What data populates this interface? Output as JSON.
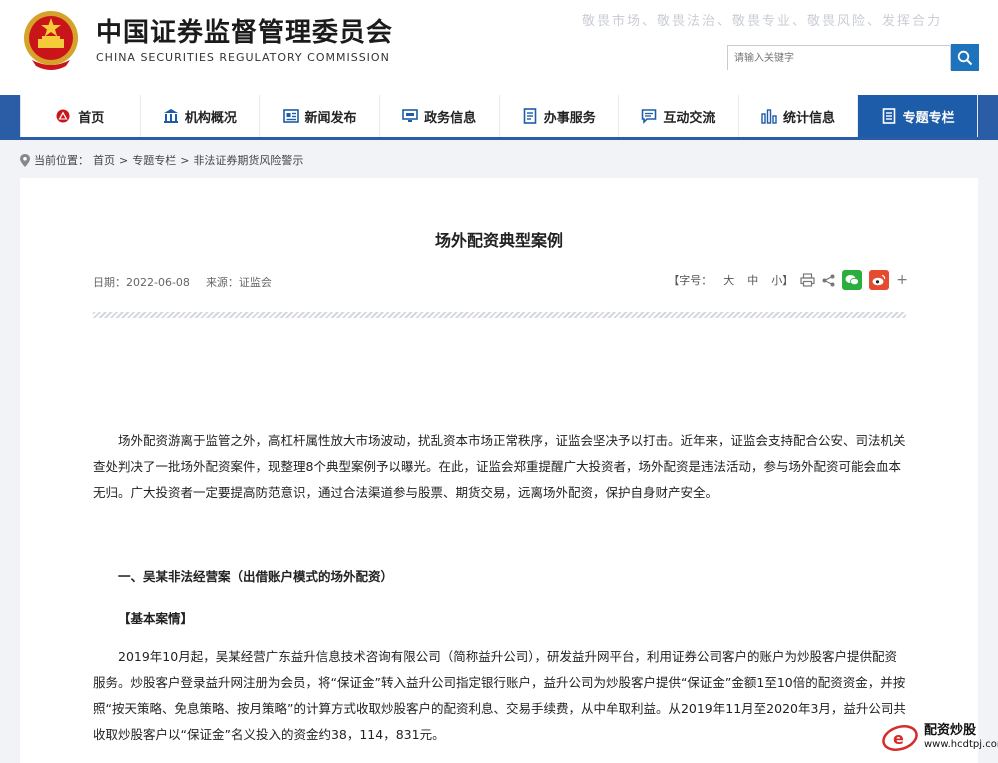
{
  "header": {
    "title_cn": "中国证券监督管理委员会",
    "title_en": "CHINA SECURITIES REGULATORY COMMISSION",
    "slogan": "敬畏市场、敬畏法治、敬畏专业、敬畏风险、发挥合力",
    "search_placeholder": "请输入关键字"
  },
  "nav": {
    "items": [
      {
        "label": "首页",
        "icon": "csrc-logo-icon"
      },
      {
        "label": "机构概况",
        "icon": "building-icon"
      },
      {
        "label": "新闻发布",
        "icon": "news-icon"
      },
      {
        "label": "政务信息",
        "icon": "monitor-icon"
      },
      {
        "label": "办事服务",
        "icon": "document-icon"
      },
      {
        "label": "互动交流",
        "icon": "chat-icon"
      },
      {
        "label": "统计信息",
        "icon": "bar-chart-icon"
      },
      {
        "label": "专题专栏",
        "icon": "topic-icon"
      }
    ],
    "active_index": 7,
    "active_color": "#1d5ca8"
  },
  "breadcrumb": {
    "prefix": "当前位置：",
    "items": [
      "首页",
      "专题专栏",
      "非法证券期货风险警示"
    ],
    "separator": ">"
  },
  "article": {
    "title": "场外配资典型案例",
    "date": "日期：2022-06-08",
    "source": "来源：证监会",
    "font_label": "【字号：",
    "font_large": "大",
    "font_medium": "中",
    "font_small": "小】",
    "plus": "+",
    "intro": "场外配资游离于监管之外，高杠杆属性放大市场波动，扰乱资本市场正常秩序，证监会坚决予以打击。近年来，证监会支持配合公安、司法机关查处判决了一批场外配资案件，现整理8个典型案例予以曝光。在此，证监会郑重提醒广大投资者，场外配资是违法活动，参与场外配资可能会血本无归。广大投资者一定要提高防范意识，通过合法渠道参与股票、期货交易，远离场外配资，保护自身财产安全。",
    "section1_heading": "一、吴某非法经营案（出借账户模式的场外配资）",
    "section1_sub": "【基本案情】",
    "section1_body": "2019年10月起，吴某经营广东益升信息技术咨询有限公司（简称益升公司），研发益升网平台，利用证券公司客户的账户为炒股客户提供配资服务。炒股客户登录益升网注册为会员，将“保证金”转入益升公司指定银行账户，益升公司为炒股客户提供“保证金”金额1至10倍的配资资金，并按照“按天策略、免息策略、按月策略”的计算方式收取炒股客户的配资利息、交易手续费，从中牟取利益。从2019年11月至2020年3月，益升公司共收取炒股客户以“保证金”名义投入的资金约38，114，831元。"
  },
  "watermark": {
    "name": "配资炒股",
    "url": "www.hcdtpj.com"
  }
}
